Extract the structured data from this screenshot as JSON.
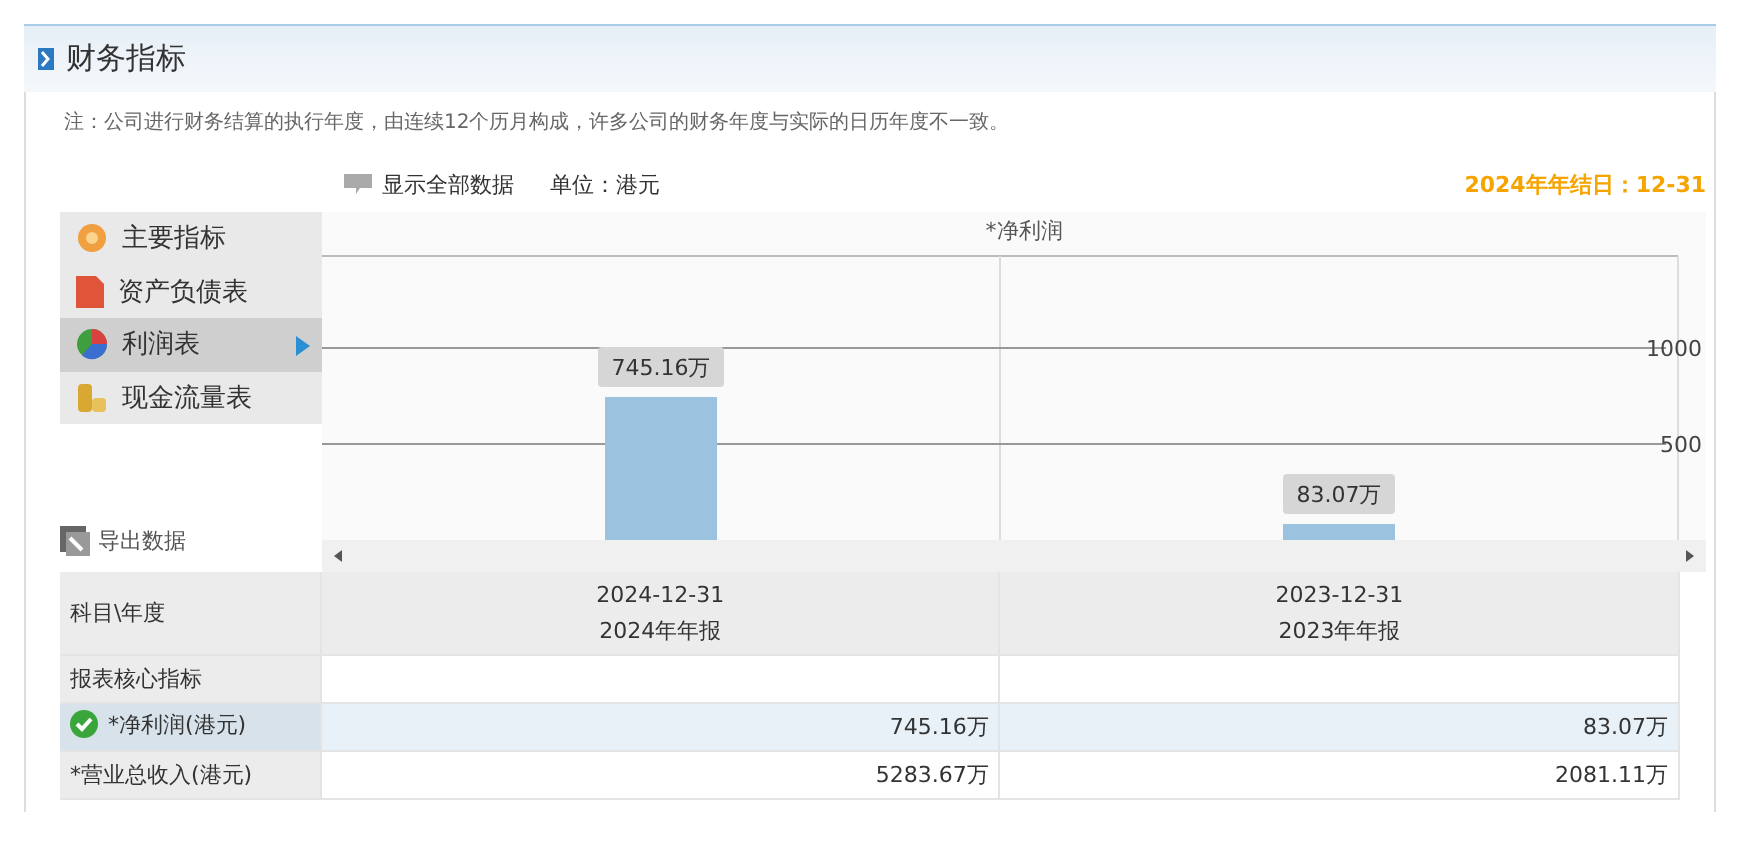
{
  "header": {
    "title": "财务指标"
  },
  "note": "注：公司进行财务结算的执行年度，由连续12个历月构成，许多公司的财务年度与实际的日历年度不一致。",
  "toolbar": {
    "show_all": "显示全部数据",
    "unit": "单位：港元",
    "year_end": "2024年年结日：12-31"
  },
  "menu": [
    {
      "label": "主要指标",
      "selected": false
    },
    {
      "label": "资产负债表",
      "selected": false
    },
    {
      "label": "利润表",
      "selected": true
    },
    {
      "label": "现金流量表",
      "selected": false
    }
  ],
  "export": "导出数据",
  "chart": {
    "chart_data": {
      "type": "bar",
      "title": "*净利润",
      "values": [
        745.16,
        83.07
      ],
      "ylim": [
        0,
        1480
      ],
      "yticks": [
        500,
        1000
      ],
      "data_labels": true,
      "value_labels": [
        "745.16万",
        "83.07万"
      ]
    }
  },
  "table": {
    "corner": "科目\\年度",
    "columns": [
      {
        "date": "2024-12-31",
        "report": "2024年年报"
      },
      {
        "date": "2023-12-31",
        "report": "2023年年报"
      }
    ],
    "rows": [
      {
        "kind": "section",
        "label": "报表核心指标",
        "selected": false
      },
      {
        "kind": "data",
        "label": "*净利润(港元)",
        "selected": true,
        "values": [
          "745.16万",
          "83.07万"
        ]
      },
      {
        "kind": "data",
        "label": "*营业总收入(港元)",
        "selected": false,
        "values": [
          "5283.67万",
          "2081.11万"
        ]
      }
    ]
  }
}
